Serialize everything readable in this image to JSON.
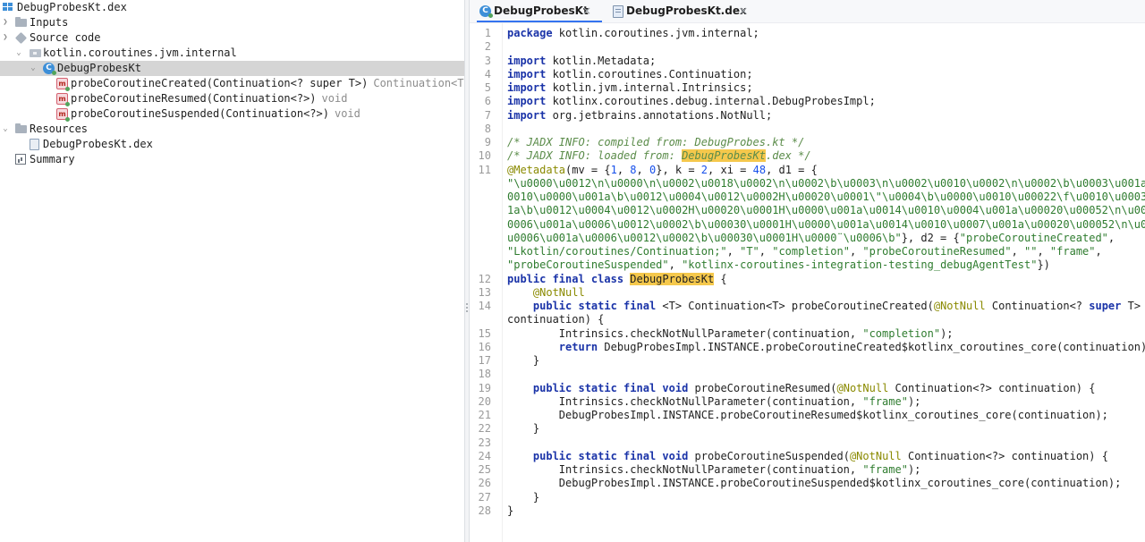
{
  "tree": {
    "root_label": "DebugProbesKt.dex",
    "inputs_label": "Inputs",
    "source_code_label": "Source code",
    "package_label": "kotlin.coroutines.jvm.internal",
    "class_label": "DebugProbesKt",
    "methods": [
      {
        "name": "probeCoroutineCreated(Continuation<? super T>)",
        "type": "Continuation<T>"
      },
      {
        "name": "probeCoroutineResumed(Continuation<?>)",
        "type": "void"
      },
      {
        "name": "probeCoroutineSuspended(Continuation<?>)",
        "type": "void"
      }
    ],
    "resources_label": "Resources",
    "resource_file_label": "DebugProbesKt.dex",
    "summary_label": "Summary"
  },
  "tabs": [
    {
      "label": "DebugProbesKt",
      "close": "×",
      "active": true
    },
    {
      "label": "DebugProbesKt.dex",
      "close": "×",
      "active": false
    }
  ],
  "editor": {
    "line_numbers": [
      "1",
      "2",
      "3",
      "4",
      "5",
      "6",
      "7",
      "8",
      "9",
      "10",
      "11",
      "",
      "",
      "",
      "",
      "",
      "",
      "12",
      "13",
      "14",
      "",
      "15",
      "16",
      "17",
      "18",
      "19",
      "20",
      "21",
      "22",
      "23",
      "24",
      "25",
      "26",
      "27",
      "28"
    ],
    "code": {
      "l1_kw": "package",
      "l1_rest": " kotlin.coroutines.jvm.internal;",
      "import_kw": "import",
      "l3_rest": " kotlin.Metadata;",
      "l4_rest": " kotlin.coroutines.Continuation;",
      "l5_rest": " kotlin.jvm.internal.Intrinsics;",
      "l6_rest": " kotlinx.coroutines.debug.internal.DebugProbesImpl;",
      "l7_rest": " org.jetbrains.annotations.NotNull;",
      "l9_comment": "/* JADX INFO: compiled from: DebugProbes.kt */",
      "l10_pre": "/* JADX INFO: loaded from: ",
      "l10_hl": "DebugProbesKt",
      "l10_post": ".dex */",
      "l11_ann": "@Metadata",
      "l11_a": "(mv = {",
      "l11_n1": "1",
      "l11_c1": ", ",
      "l11_n2": "8",
      "l11_c2": ", ",
      "l11_n3": "0",
      "l11_b": "}, k = ",
      "l11_n4": "2",
      "l11_c": ", xi = ",
      "l11_n5": "48",
      "l11_d": ", d1 = {",
      "w1": "\"\\u0000\\u0012\\n\\u0000\\n\\u0002\\u0018\\u0002\\n\\u0002\\b\\u0003\\n\\u0002\\u0010\\u0002\\n\\u0002\\b\\u0003\\u001a\\\"\\u",
      "w2": "0010\\u0000\\u001a\\b\\u0012\\u0004\\u0012\\u0002H\\u00020\\u0001\\\"\\u0004\\b\\u0000\\u0010\\u00022\\f\\u0010\\u0003\\u00",
      "w3": "1a\\b\\u0012\\u0004\\u0012\\u0002H\\u00020\\u0001H\\u0000\\u001a\\u0014\\u0010\\u0004\\u001a\\u00020\\u00052\\n\\u0010\\u",
      "w4": "0006\\u001a\\u0006\\u0012\\u0002\\b\\u00030\\u0001H\\u0000\\u001a\\u0014\\u0010\\u0007\\u001a\\u00020\\u00052\\n\\u0010\\",
      "w5_str": "u0006\\u001a\\u0006\\u0012\\u0002\\b\\u00030\\u0001H\\u0000¨\\u0006\\b\"",
      "w5_rest": "}, d2 = {",
      "w5_str2": "\"probeCoroutineCreated\"",
      "w5_end": ",",
      "w6_s1": "\"Lkotlin/coroutines/Continuation;\"",
      "w6_c1": ", ",
      "w6_s2": "\"T\"",
      "w6_c2": ", ",
      "w6_s3": "\"completion\"",
      "w6_c3": ", ",
      "w6_s4": "\"probeCoroutineResumed\"",
      "w6_c4": ", ",
      "w6_s5": "\"\"",
      "w6_c5": ", ",
      "w6_s6": "\"frame\"",
      "w6_c6": ",",
      "w7_s1": "\"probeCoroutineSuspended\"",
      "w7_c1": ", ",
      "w7_s2": "\"kotlinx-coroutines-integration-testing_debugAgentTest\"",
      "w7_end": "})",
      "l12_kw": "public final class",
      "l12_sp": " ",
      "l12_name": "DebugProbesKt",
      "l12_end": " {",
      "l13_ann": "    @NotNull",
      "l14_ind": "    ",
      "kw_psf": "public static final",
      "l14_a": " <T> Continuation<T> probeCoroutineCreated(",
      "ann_nn": "@NotNull",
      "l14_b": " Continuation<? ",
      "kw_super": "super",
      "l14_c": " T>",
      "l14w": "continuation) {",
      "l15_a": "        Intrinsics.checkNotNullParameter(continuation, ",
      "l15_s": "\"completion\"",
      "l15_e": ");",
      "l16_ind": "        ",
      "kw_return": "return",
      "l16_rest": " DebugProbesImpl.INSTANCE.probeCoroutineCreated$kotlinx_coroutines_core(continuation);",
      "close_brace_ind": "    }",
      "l19_ind": "    ",
      "kw_void": "void",
      "l19_a": " probeCoroutineResumed(",
      "l19_b": " Continuation<?> continuation) {",
      "l20_a": "        Intrinsics.checkNotNullParameter(continuation, ",
      "str_frame": "\"frame\"",
      "l20_e": ");",
      "l21": "        DebugProbesImpl.INSTANCE.probeCoroutineResumed$kotlinx_coroutines_core(continuation);",
      "l24_ind": "    ",
      "l24_a": " probeCoroutineSuspended(",
      "l24_b": " Continuation<?> continuation) {",
      "l25_a": "        Intrinsics.checkNotNullParameter(continuation, ",
      "l25_e": ");",
      "l26": "        DebugProbesImpl.INSTANCE.probeCoroutineSuspended$kotlinx_coroutines_core(continuation);",
      "l28": "}"
    }
  }
}
